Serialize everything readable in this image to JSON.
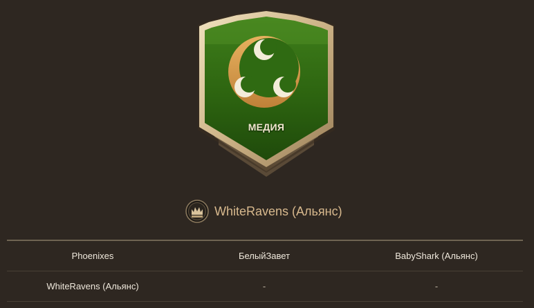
{
  "emblem": {
    "title": "МЕДИЯ",
    "icon": "crescent-three-moons-icon",
    "colors": {
      "shield_green": "#2f6a12",
      "shield_border": "#d6c29a",
      "crescent": "#d49a4c",
      "moons": "#f3ecd9"
    }
  },
  "alliance": {
    "icon": "crown-badge-icon",
    "name": "WhiteRavens (Альянс)"
  },
  "table": {
    "rows": [
      {
        "c1": "Phoenixes",
        "c2": "БелыйЗавет",
        "c3": "BabyShark (Альянс)"
      },
      {
        "c1": "WhiteRavens (Альянс)",
        "c2": "-",
        "c3": "-"
      }
    ]
  }
}
